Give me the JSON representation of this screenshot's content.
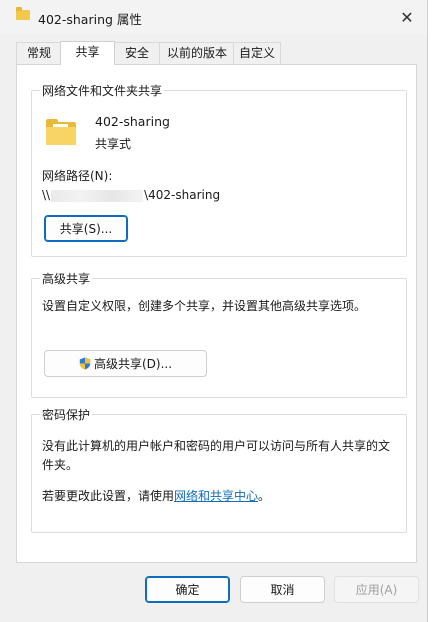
{
  "window": {
    "title": "402-sharing 属性",
    "close_glyph": "✕"
  },
  "tabs": [
    "常规",
    "共享",
    "安全",
    "以前的版本",
    "自定义"
  ],
  "active_tab": "共享",
  "network_sharing": {
    "group_title": "网络文件和文件夹共享",
    "folder_name": "402-sharing",
    "share_status": "共享式",
    "path_label": "网络路径(N):",
    "path_prefix": "\\\\",
    "path_suffix": "\\402-sharing",
    "share_button": "共享(S)..."
  },
  "advanced_sharing": {
    "group_title": "高级共享",
    "description": "设置自定义权限，创建多个共享，并设置其他高级共享选项。",
    "button": "高级共享(D)..."
  },
  "password_protection": {
    "group_title": "密码保护",
    "description_line1": "没有此计算机的用户帐户和密码的用户可以访问与所有人共享的文",
    "description_line2": "件夹。",
    "change_prefix": "若要更改此设置，请使用",
    "link_text": "网络和共享中心",
    "change_suffix": "。"
  },
  "footer": {
    "ok": "确定",
    "cancel": "取消",
    "apply": "应用(A)"
  },
  "colors": {
    "accent": "#0f6cbd",
    "folder": "#f2c94c"
  },
  "icons": [
    "folder-icon",
    "close-icon",
    "uac-shield-icon"
  ]
}
